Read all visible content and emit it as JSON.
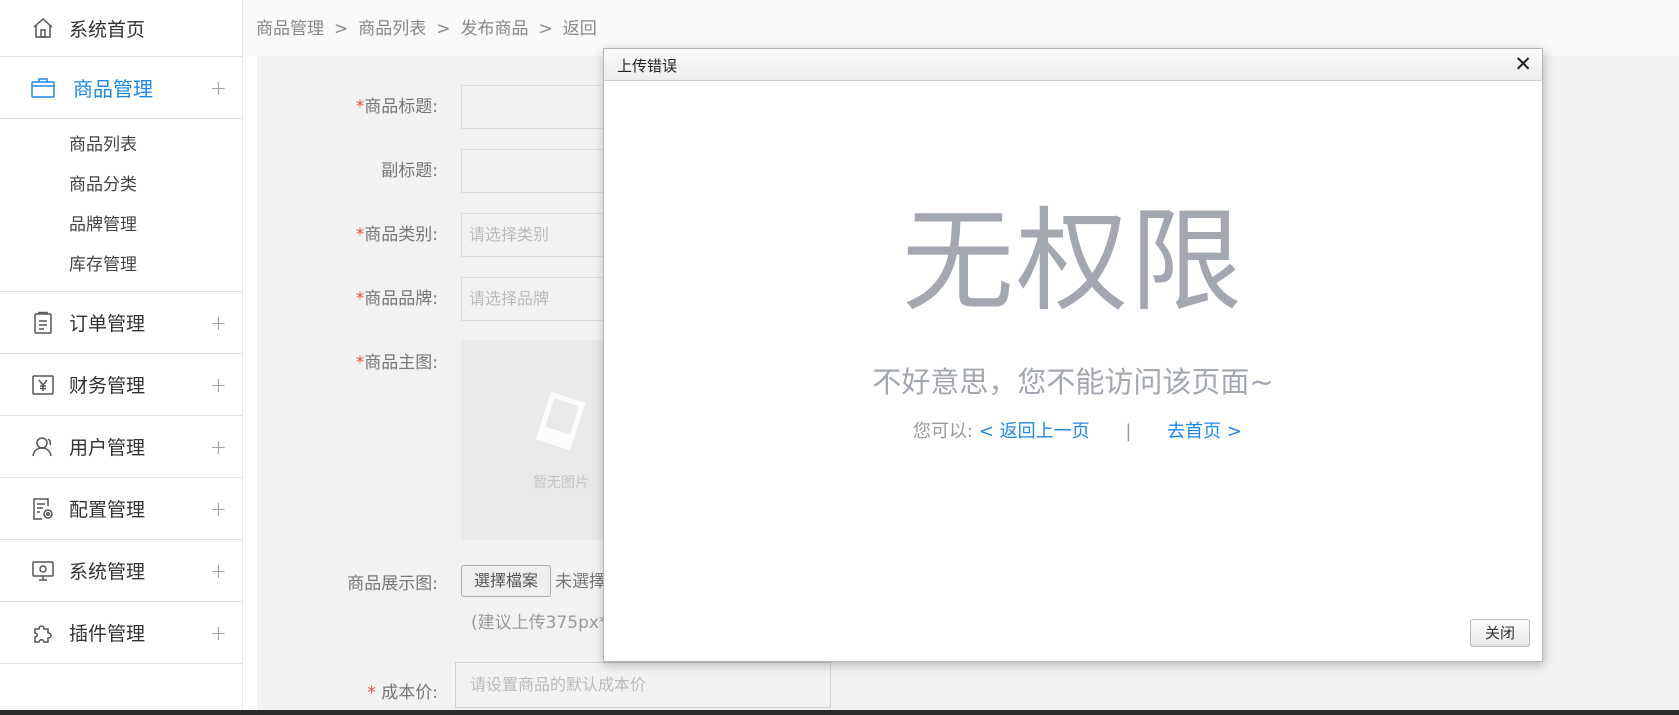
{
  "sidebar": {
    "home": "系统首页",
    "goods": "商品管理",
    "goods_sub": [
      "商品列表",
      "商品分类",
      "品牌管理",
      "库存管理"
    ],
    "orders": "订单管理",
    "finance": "财务管理",
    "users": "用户管理",
    "config": "配置管理",
    "system": "系统管理",
    "plugins": "插件管理",
    "expand_symbol": "+"
  },
  "breadcrumb": [
    "商品管理",
    "商品列表",
    "发布商品",
    "返回"
  ],
  "breadcrumb_sep": ">",
  "form": {
    "required_mark": "*",
    "title_label": "商品标题:",
    "subtitle_label": "副标题:",
    "category_label": "商品类别:",
    "category_placeholder": "请选择类别",
    "brand_label": "商品品牌:",
    "brand_placeholder": "请选择品牌",
    "main_image_label": "商品主图:",
    "no_image_text": "暂无图片",
    "gallery_label": "商品展示图:",
    "file_button": "選擇檔案",
    "file_status": "未選擇",
    "gallery_hint": "(建议上传375px*",
    "cost_label": "成本价:",
    "cost_placeholder": "请设置商品的默认成本价"
  },
  "dialog": {
    "title": "上传错误",
    "close_symbol": "✕",
    "big_text": "无权限",
    "message": "不好意思，您不能访问该页面~",
    "you_can": "您可以:",
    "back_link": "< 返回上一页",
    "pipe": "|",
    "home_link": "去首页 >",
    "close_button": "关闭"
  },
  "colors": {
    "accent": "#1e88e5",
    "required": "#e84a3b",
    "muted": "#a3a7b0"
  }
}
